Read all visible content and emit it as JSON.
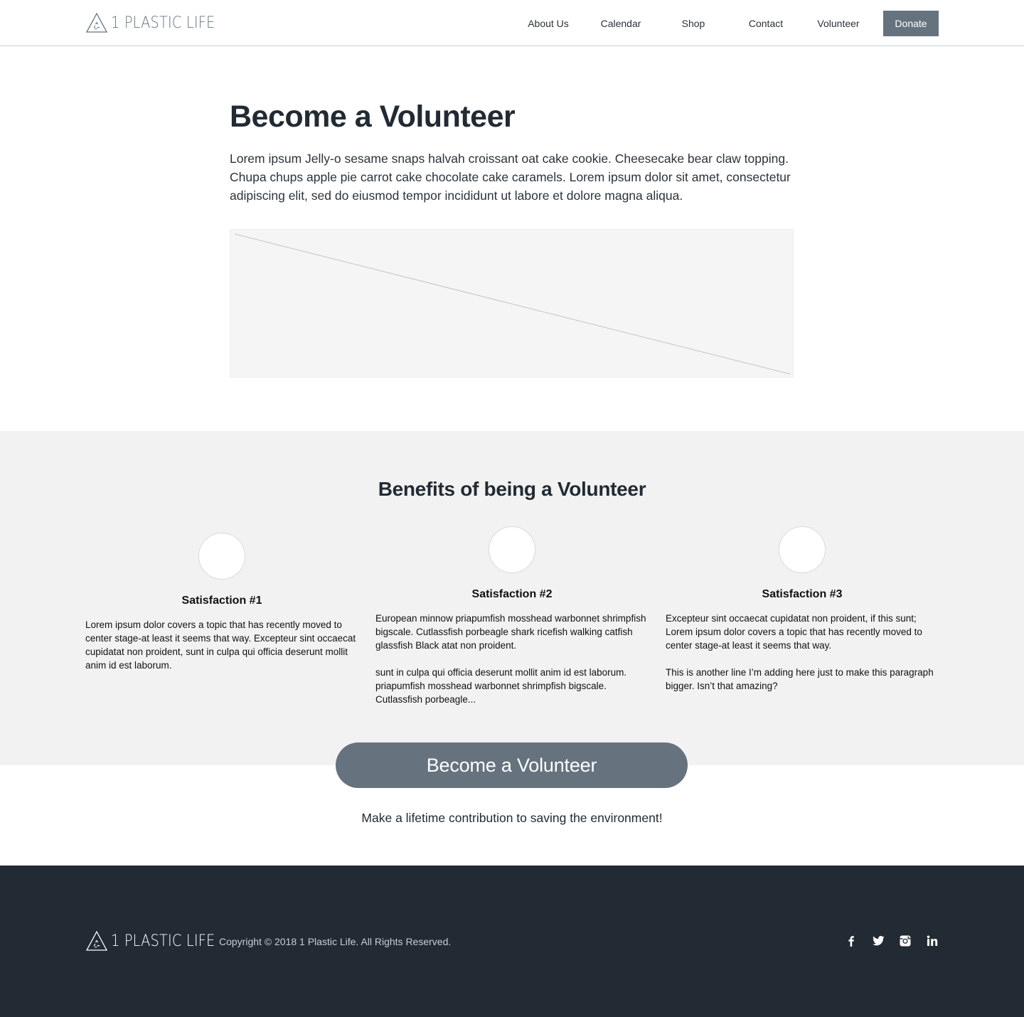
{
  "brand": {
    "name": "1 PLASTIC LIFE"
  },
  "nav": {
    "items": [
      {
        "label": "About Us"
      },
      {
        "label": "Calendar"
      },
      {
        "label": "Shop"
      },
      {
        "label": "Contact"
      },
      {
        "label": "Volunteer"
      }
    ],
    "donate_label": "Donate"
  },
  "intro": {
    "title": "Become a Volunteer",
    "text": "Lorem ipsum Jelly-o sesame snaps halvah croissant oat cake cookie. Cheesecake bear claw topping. Chupa chups apple pie carrot cake chocolate cake caramels. Lorem ipsum dolor sit amet, consectetur adipiscing elit, sed do eiusmod tempor incididunt ut labore et dolore magna aliqua."
  },
  "benefits": {
    "title": "Benefits of being a Volunteer",
    "items": [
      {
        "title": "Satisfaction #1",
        "paragraphs": [
          "Lorem ipsum dolor covers a topic that has recently moved to center stage-at least it seems that way. Excepteur sint occaecat cupidatat non proident, sunt in culpa qui officia deserunt mollit anim id est laborum."
        ]
      },
      {
        "title": "Satisfaction #2",
        "paragraphs": [
          "European minnow priapumfish mosshead warbonnet shrimpfish bigscale. Cutlassfish porbeagle shark ricefish walking catfish glassfish Black atat non proident.",
          "sunt in culpa qui officia deserunt mollit anim id est laborum. priapumfish mosshead warbonnet shrimpfish bigscale. Cutlassfish porbeagle..."
        ]
      },
      {
        "title": "Satisfaction #3",
        "paragraphs": [
          "Excepteur sint occaecat cupidatat non proident, if this sunt; Lorem ipsum dolor covers a topic that has recently moved to center stage-at least it seems that way.",
          "This is another line I’m adding here just to make this paragraph bigger. Isn’t that amazing?"
        ]
      }
    ]
  },
  "cta": {
    "button_label": "Become a Volunteer",
    "subtext": "Make a lifetime contribution to saving the environment!"
  },
  "footer": {
    "copyright": "Copyright © 2018 1 Plastic Life. All Rights Reserved.",
    "social_icons": [
      "facebook-icon",
      "twitter-icon",
      "instagram-icon",
      "linkedin-icon"
    ]
  },
  "colors": {
    "primary": "#66737f",
    "dark": "#222b33",
    "section_bg": "#f2f2f2",
    "placeholder_bg": "#f4f5f4"
  }
}
